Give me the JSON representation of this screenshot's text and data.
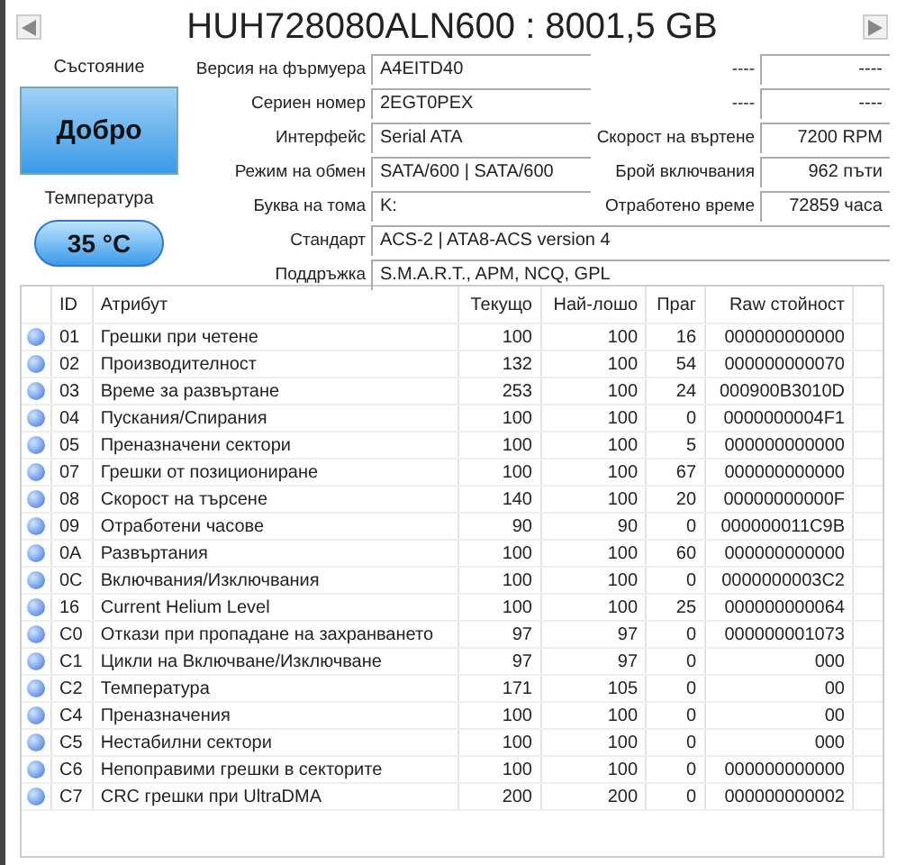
{
  "disk_title": "HUH728080ALN600 : 8001,5 GB",
  "status": {
    "label": "Състояние",
    "value": "Добро"
  },
  "temperature": {
    "label": "Температура",
    "value": "35 °C"
  },
  "details": [
    {
      "label": "Версия на фърмуера",
      "value": "A4EITD40"
    },
    {
      "label": "Сериен номер",
      "value": "2EGT0PEX"
    },
    {
      "label": "Интерфейс",
      "value": "Serial ATA"
    },
    {
      "label": "Режим на обмен",
      "value": "SATA/600 | SATA/600"
    },
    {
      "label": "Буква на тома",
      "value": "K:"
    },
    {
      "label": "Стандарт",
      "value": "ACS-2 | ATA8-ACS version 4"
    },
    {
      "label": "Поддръжка",
      "value": "S.M.A.R.T., APM, NCQ, GPL"
    }
  ],
  "counters": [
    {
      "label": "----",
      "value": "----"
    },
    {
      "label": "----",
      "value": "----"
    },
    {
      "label": "Скорост на въртене",
      "value": "7200 RPM"
    },
    {
      "label": "Брой включвания",
      "value": "962 пъти"
    },
    {
      "label": "Отработено време",
      "value": "72859 часа"
    }
  ],
  "table": {
    "columns": [
      "ID",
      "Атрибут",
      "Текущо",
      "Най-лошо",
      "Праг",
      "Raw стойност"
    ],
    "rows": [
      {
        "cells": [
          "01",
          "Грешки при четене",
          "100",
          "100",
          "16",
          "000000000000"
        ]
      },
      {
        "cells": [
          "02",
          "Производителност",
          "132",
          "100",
          "54",
          "000000000070"
        ]
      },
      {
        "cells": [
          "03",
          "Време за развъртане",
          "253",
          "100",
          "24",
          "000900B3010D"
        ]
      },
      {
        "cells": [
          "04",
          "Пускания/Спирания",
          "100",
          "100",
          "0",
          "0000000004F1"
        ]
      },
      {
        "cells": [
          "05",
          "Преназначени сектори",
          "100",
          "100",
          "5",
          "000000000000"
        ]
      },
      {
        "cells": [
          "07",
          "Грешки от позициониране",
          "100",
          "100",
          "67",
          "000000000000"
        ]
      },
      {
        "cells": [
          "08",
          "Скорост на търсене",
          "140",
          "100",
          "20",
          "00000000000F"
        ]
      },
      {
        "cells": [
          "09",
          "Отработени часове",
          "90",
          "90",
          "0",
          "000000011C9B"
        ]
      },
      {
        "cells": [
          "0A",
          "Развъртания",
          "100",
          "100",
          "60",
          "000000000000"
        ]
      },
      {
        "cells": [
          "0C",
          "Включвания/Изключвания",
          "100",
          "100",
          "0",
          "0000000003C2"
        ]
      },
      {
        "cells": [
          "16",
          "Current Helium Level",
          "100",
          "100",
          "25",
          "000000000064"
        ]
      },
      {
        "cells": [
          "C0",
          "Откази при пропадане на захранването",
          "97",
          "97",
          "0",
          "000000001073"
        ]
      },
      {
        "cells": [
          "C1",
          "Цикли на Включване/Изключване",
          "97",
          "97",
          "0",
          "000"
        ]
      },
      {
        "cells": [
          "C2",
          "Температура",
          "171",
          "105",
          "0",
          "00"
        ]
      },
      {
        "cells": [
          "C4",
          "Преназначения",
          "100",
          "100",
          "0",
          "00"
        ]
      },
      {
        "cells": [
          "C5",
          "Нестабилни сектори",
          "100",
          "100",
          "0",
          "000"
        ]
      },
      {
        "cells": [
          "C6",
          "Непоправими грешки в секторите",
          "100",
          "100",
          "0",
          "000000000000"
        ]
      },
      {
        "cells": [
          "C7",
          "CRC грешки при UltraDMA",
          "200",
          "200",
          "0",
          "000000000002"
        ]
      }
    ]
  }
}
